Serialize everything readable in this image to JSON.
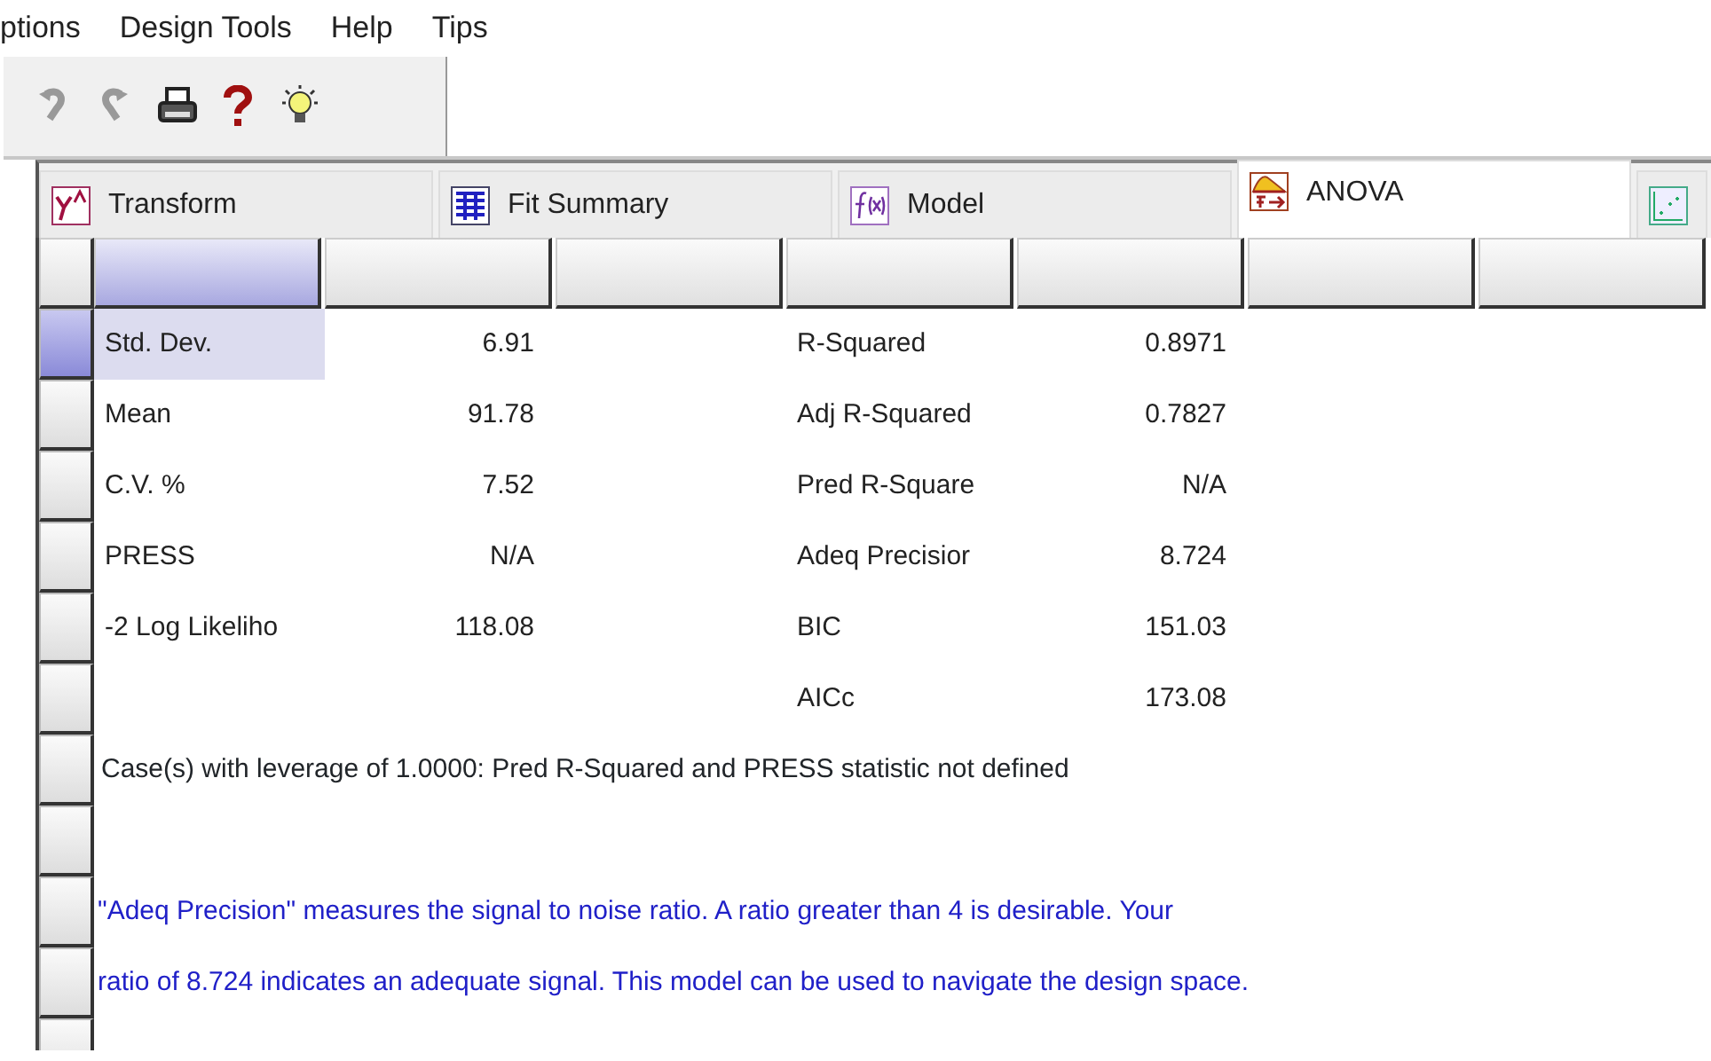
{
  "menu": [
    "ptions",
    "Design Tools",
    "Help",
    "Tips"
  ],
  "toolbar": [
    {
      "disabled": true
    },
    {
      "disabled": true
    },
    {
      "disabled": false
    },
    {
      "disabled": false
    },
    {
      "disabled": false
    }
  ],
  "tabs": [
    {
      "label": "Transform",
      "selected": false
    },
    {
      "label": "Fit Summary",
      "selected": false
    },
    {
      "label": "Model",
      "selected": false
    },
    {
      "label": "ANOVA",
      "selected": true
    },
    {
      "selected": false
    }
  ],
  "columns": [
    {
      "selected": true
    },
    {
      "selected": false
    },
    {
      "selected": false
    },
    {
      "selected": false
    },
    {
      "selected": false
    },
    {
      "selected": false
    },
    {
      "selected": false
    }
  ],
  "rows": [
    {
      "kind": "stat",
      "selected": true,
      "cells": [
        "Std. Dev.",
        "6.91",
        "R-Squared",
        "0.8971"
      ]
    },
    {
      "kind": "stat",
      "selected": false,
      "cells": [
        "Mean",
        "91.78",
        "Adj R-Squared",
        "0.7827"
      ]
    },
    {
      "kind": "stat",
      "selected": false,
      "cells": [
        "C.V. %",
        "7.52",
        "Pred R-Square",
        "N/A"
      ]
    },
    {
      "kind": "stat",
      "selected": false,
      "cells": [
        "PRESS",
        "N/A",
        "Adeq Precisior",
        "8.724"
      ]
    },
    {
      "kind": "stat",
      "selected": false,
      "cells": [
        "-2 Log Likeliho",
        "118.08",
        "BIC",
        "151.03"
      ]
    },
    {
      "kind": "stat",
      "selected": false,
      "cells": [
        "",
        "",
        "AICc",
        "173.08"
      ]
    },
    {
      "kind": "note",
      "selected": false,
      "text": "Case(s) with leverage of 1.0000: Pred R-Squared and PRESS statistic not defined"
    },
    {
      "kind": "blank",
      "selected": false
    },
    {
      "kind": "advice",
      "selected": false,
      "text": "\"Adeq Precision\" measures the signal to noise ratio. A ratio greater than 4 is desirable. Your"
    },
    {
      "kind": "advice",
      "selected": false,
      "text": "ratio of 8.724 indicates an adequate signal. This model can be used to navigate the design space."
    },
    {
      "kind": "blank",
      "selected": false
    }
  ]
}
